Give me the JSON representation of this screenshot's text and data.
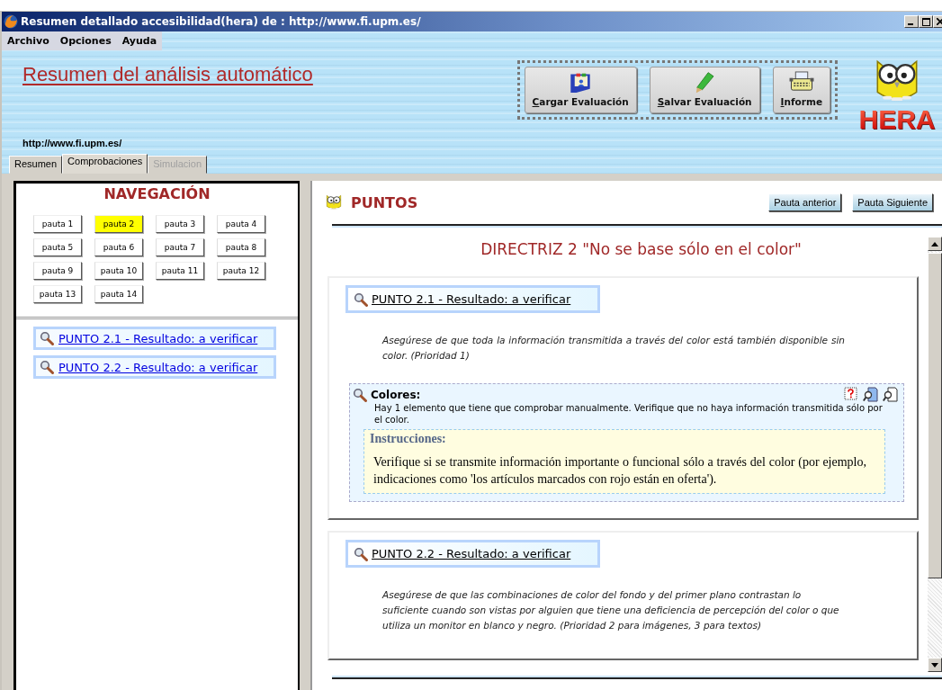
{
  "window": {
    "title": "Resumen detallado accesibilidad(hera) de : http://www.fi.upm.es/"
  },
  "menu": [
    "Archivo",
    "Opciones",
    "Ayuda"
  ],
  "header": {
    "title": "Resumen del análisis automático",
    "url": "http://www.fi.upm.es/",
    "logo": "HERA"
  },
  "toolbar": [
    {
      "label": "Cargar Evaluación",
      "kind": "load"
    },
    {
      "label": "Salvar Evaluación",
      "kind": "save"
    },
    {
      "label": "Informe",
      "kind": "report"
    }
  ],
  "tabs": [
    {
      "label": "Resumen",
      "selected": false,
      "disabled": false
    },
    {
      "label": "Comprobaciones",
      "selected": true,
      "disabled": false
    },
    {
      "label": "Simulacion",
      "selected": false,
      "disabled": true
    }
  ],
  "navigation": {
    "title": "NAVEGACIÓN",
    "pautas": [
      {
        "label": "pauta 1",
        "selected": false
      },
      {
        "label": "pauta 2",
        "selected": true
      },
      {
        "label": "pauta 3",
        "selected": false
      },
      {
        "label": "pauta 4",
        "selected": false
      },
      {
        "label": "pauta 5",
        "selected": false
      },
      {
        "label": "pauta 6",
        "selected": false
      },
      {
        "label": "pauta 7",
        "selected": false
      },
      {
        "label": "pauta 8",
        "selected": false
      },
      {
        "label": "pauta 9",
        "selected": false
      },
      {
        "label": "pauta 10",
        "selected": false
      },
      {
        "label": "pauta 11",
        "selected": false
      },
      {
        "label": "pauta 12",
        "selected": false
      },
      {
        "label": "pauta 13",
        "selected": false
      },
      {
        "label": "pauta 14",
        "selected": false
      }
    ],
    "links": [
      "PUNTO 2.1 - Resultado: a verificar",
      "PUNTO 2.2 - Resultado: a verificar"
    ]
  },
  "puntos": {
    "title": "PUNTOS",
    "buttons": [
      "Pauta anterior",
      "Pauta Siguiente"
    ],
    "directriz": "DIRECTRIZ 2 \"No se base sólo en el color\"",
    "items": [
      {
        "heading": "PUNTO 2.1 - Resultado: a verificar",
        "description": "Asegúrese de que toda la información transmitida a través del color está también disponible sin color. (Prioridad 1)",
        "justified": true,
        "checks": [
          {
            "title": "Colores:",
            "text": "Hay 1 elemento que tiene que comprobar manualmente. Verifique que no haya información transmitida sólo por el color.",
            "instructions_title": "Instrucciones:",
            "instructions": "Verifique si se transmite información importante o funcional sólo a través del color (por ejemplo, indicaciones como 'los artículos marcados con rojo están en oferta')."
          }
        ]
      },
      {
        "heading": "PUNTO 2.2 - Resultado: a verificar",
        "description": "Asegúrese de que las combinaciones de color del fondo y del primer plano contrastan lo suficiente cuando son vistas por alguien que tiene una deficiencia de percepción del color o que utiliza un monitor en blanco y negro. (Prioridad 2 para imágenes, 3 para textos)",
        "justified": false
      }
    ]
  }
}
